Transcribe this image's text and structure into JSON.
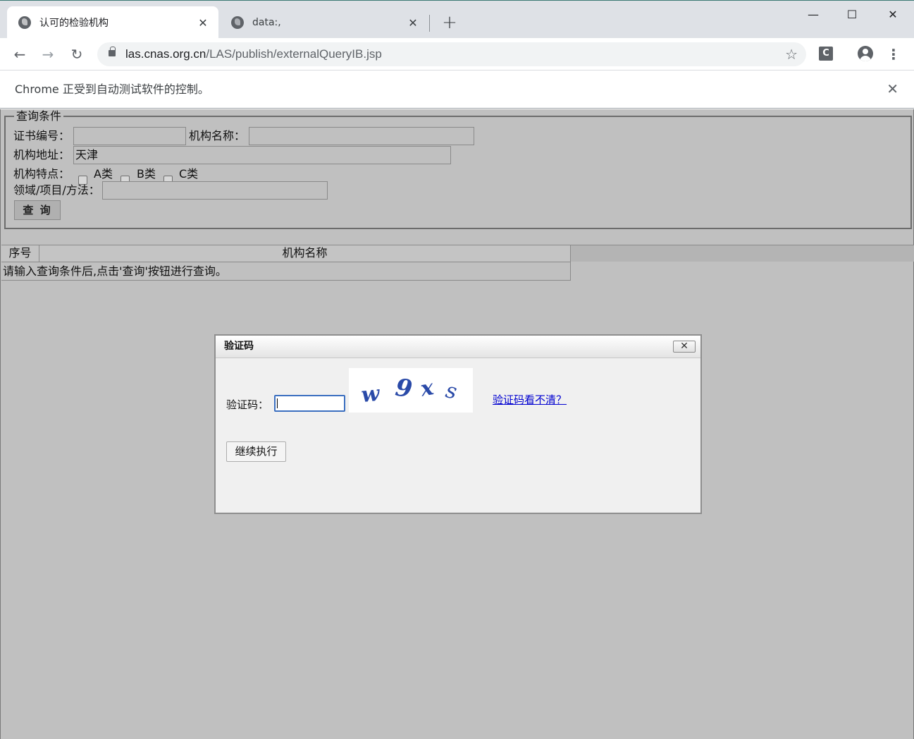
{
  "browser": {
    "tabs": [
      {
        "title": "认可的检验机构",
        "active": true
      },
      {
        "title": "data:,",
        "active": false
      }
    ],
    "new_tab": "+",
    "window_controls": {
      "minimize": "—",
      "maximize": "☐",
      "close": "✕"
    },
    "nav": {
      "back": "←",
      "forward": "→",
      "reload": "↻"
    },
    "url_host": "las.cnas.org.cn",
    "url_path": "/LAS/publish/externalQueryIB.jsp",
    "extension_letter": "C",
    "menu": "⋮",
    "star": "☆",
    "infobar_message": "Chrome 正受到自动测试软件的控制。",
    "infobar_close": "✕"
  },
  "query": {
    "legend": "查询条件",
    "cert_no_label": "证书编号：",
    "cert_no_value": "",
    "org_name_label": "机构名称：",
    "org_name_value": "",
    "address_label": "机构地址：",
    "address_value": "天津",
    "feature_label": "机构特点：",
    "checkboxes": [
      "A类",
      "B类",
      "C类"
    ],
    "field_label": "领域/项目/方法：",
    "field_value": "",
    "search_button": "查 询"
  },
  "results": {
    "columns": [
      "序号",
      "机构名称"
    ],
    "empty_message": "请输入查询条件后,点击'查询'按钮进行查询。"
  },
  "captcha_dialog": {
    "title": "验证码",
    "close": "✕",
    "label": "验证码：",
    "input_value": "",
    "captcha_text": "w 9 x s",
    "refresh_link": "验证码看不清？",
    "continue_button": "继续执行"
  },
  "colors": {
    "page_background": "#c0c0c0",
    "link": "#0000d0",
    "captcha_ink": "#2a4aa8",
    "tabstrip": "#dee1e6"
  }
}
